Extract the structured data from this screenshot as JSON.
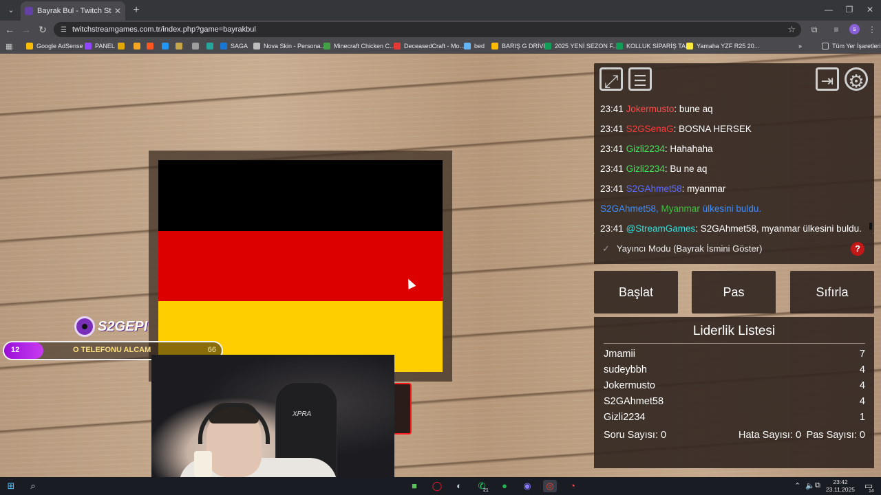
{
  "browser": {
    "tab_title": "Bayrak Bul - Twitch Stream Games",
    "url": "twitchstreamgames.com.tr/index.php?game=bayrakbul",
    "profile_initial": "s",
    "bookmarks": [
      {
        "label": "Google AdSense",
        "color": "#fbbc04"
      },
      {
        "label": "PANEL",
        "color": "#9146ff"
      },
      {
        "label": "",
        "color": "#e0a800"
      },
      {
        "label": "",
        "color": "#f5a623"
      },
      {
        "label": "",
        "color": "#ff5722"
      },
      {
        "label": "",
        "color": "#2196f3"
      },
      {
        "label": "",
        "color": "#c7a64b"
      },
      {
        "label": "",
        "color": "#9e9e9e"
      },
      {
        "label": "",
        "color": "#26a69a"
      },
      {
        "label": "SAGA",
        "color": "#1976d2"
      },
      {
        "label": "Nova Skin - Persona...",
        "color": "#bdbdbd"
      },
      {
        "label": "Minecraft Chicken C...",
        "color": "#43a047"
      },
      {
        "label": "DeceasedCraft - Mo...",
        "color": "#e53935"
      },
      {
        "label": "bed",
        "color": "#64b5f6"
      },
      {
        "label": "BARIŞ G DRİVE",
        "color": "#fbbc04"
      },
      {
        "label": "2025 YENİ SEZON F...",
        "color": "#0f9d58"
      },
      {
        "label": "KOLLUK SİPARİŞ TA...",
        "color": "#0f9d58"
      },
      {
        "label": "Yamaha YZF R25 20...",
        "color": "#ffeb3b"
      }
    ],
    "all_bookmarks": "Tüm Yer İşaretleri"
  },
  "overlay": {
    "logo_text": "S2GEPI",
    "goal": {
      "left": "12",
      "title": "O TELEFONU ALCAM",
      "right": "66",
      "progress": 0.18
    }
  },
  "chair_brand": "XPRA",
  "flag": {
    "stripes": [
      "#000000",
      "#dd0000",
      "#ffce00"
    ]
  },
  "chat": {
    "lines": [
      {
        "time": "23:41",
        "user": "Jokermusto",
        "user_color": "#ff4a4a",
        "msg": ": bune aq",
        "msg_color": "#ffffff"
      },
      {
        "time": "23:41",
        "user": "S2GSenaG",
        "user_color": "#ff3b3b",
        "msg": ": BOSNA HERSEK",
        "msg_color": "#ffffff"
      },
      {
        "time": "23:41",
        "user": "Gizli2234",
        "user_color": "#3ee85a",
        "msg": ": Hahahaha",
        "msg_color": "#ffffff"
      },
      {
        "time": "23:41",
        "user": "Gizli2234",
        "user_color": "#3ee85a",
        "msg": ": Bu ne aq",
        "msg_color": "#ffffff"
      },
      {
        "time": "23:41",
        "user": "S2GAhmet58",
        "user_color": "#5a6bff",
        "msg": ": myanmar",
        "msg_color": "#ffffff"
      },
      {
        "time": "",
        "user": "S2GAhmet58,",
        "user_color": "#3d8dff",
        "extra": " Myanmar",
        "extra_color": "#3ec23e",
        "msg": " ülkesini buldu.",
        "msg_color": "#3d8dff"
      },
      {
        "time": "23:41",
        "user": "@StreamGames",
        "user_color": "#2fe0e0",
        "msg": ": S2GAhmet58, myanmar ülkesini buldu.",
        "msg_color": "#ffffff"
      }
    ]
  },
  "streamer_mode": {
    "label": "Yayıncı Modu (Bayrak İsmini Göster)",
    "help": "?"
  },
  "buttons": {
    "start": "Başlat",
    "pass": "Pas",
    "reset": "Sıfırla"
  },
  "leaderboard": {
    "title": "Liderlik Listesi",
    "rows": [
      {
        "name": "Jmamii",
        "score": "7"
      },
      {
        "name": "sudeybbh",
        "score": "4"
      },
      {
        "name": "Jokermusto",
        "score": "4"
      },
      {
        "name": "S2GAhmet58",
        "score": "4"
      },
      {
        "name": "Gizli2234",
        "score": "1"
      }
    ],
    "question_count": "Soru Sayısı: 0",
    "error_count": "Hata Sayısı: 0",
    "pass_count": "Pas Sayısı: 0"
  },
  "taskbar": {
    "time": "23:42",
    "date": "23.11.2025",
    "whatsapp_badge": "21",
    "notif_count": "14"
  }
}
